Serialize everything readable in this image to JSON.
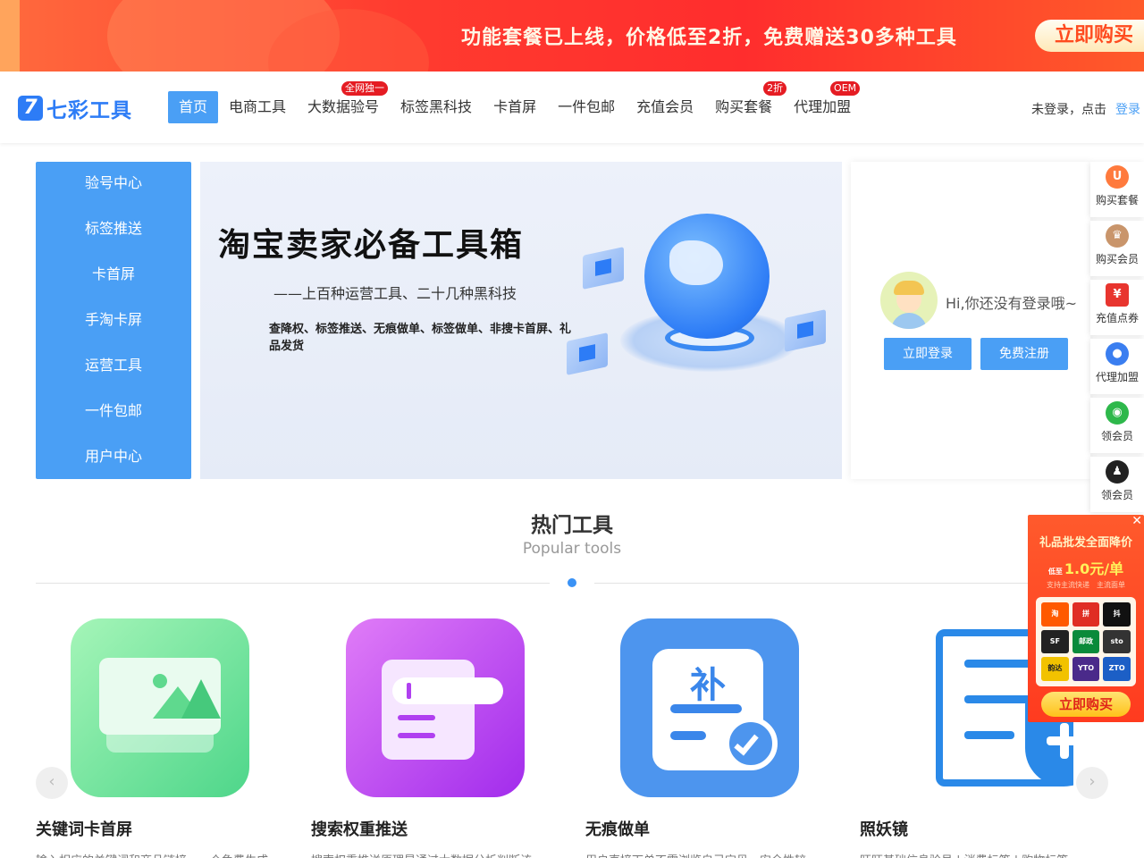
{
  "promo": {
    "text": "功能套餐已上线，价格低至2折，免费赠送30多种工具",
    "button": "立即购买"
  },
  "header": {
    "logo_mark": "7",
    "logo_text": "七彩工具",
    "nav": [
      {
        "label": "首页",
        "active": true,
        "badge": ""
      },
      {
        "label": "电商工具",
        "badge": ""
      },
      {
        "label": "大数据验号",
        "badge": "全网独一"
      },
      {
        "label": "标签黑科技",
        "badge": ""
      },
      {
        "label": "卡首屏",
        "badge": ""
      },
      {
        "label": "一件包邮",
        "badge": ""
      },
      {
        "label": "充值会员",
        "badge": ""
      },
      {
        "label": "购买套餐",
        "badge": "2折"
      },
      {
        "label": "代理加盟",
        "badge": "OEM"
      }
    ],
    "login_hint": "未登录，点击",
    "login_link": "登录"
  },
  "categories": [
    "验号中心",
    "标签推送",
    "卡首屏",
    "手淘卡屏",
    "运营工具",
    "一件包邮",
    "用户中心"
  ],
  "hero": {
    "title": "淘宝卖家必备工具箱",
    "subtitle": "——上百种运营工具、二十几种黑科技",
    "desc": "查降权、标签推送、无痕做单、标签做单、非搜卡首屏、礼品发货"
  },
  "login_panel": {
    "greeting": "Hi,你还没有登录哦~",
    "login_button": "立即登录",
    "register_button": "免费注册"
  },
  "side": [
    {
      "label": "购买套餐",
      "icon": "bag-icon",
      "color": "#ff7a3d",
      "glyph": "U"
    },
    {
      "label": "购买会员",
      "icon": "crown-icon",
      "color": "#c9956b",
      "glyph": "♛"
    },
    {
      "label": "充值点券",
      "icon": "coupon-icon",
      "color": "#e8352f",
      "glyph": "¥"
    },
    {
      "label": "代理加盟",
      "icon": "users-icon",
      "color": "#3a7ef0",
      "glyph": "●"
    },
    {
      "label": "领会员",
      "icon": "wechat-icon",
      "color": "#2eb84b",
      "glyph": "◉"
    },
    {
      "label": "领会员",
      "icon": "qq-icon",
      "color": "#222222",
      "glyph": "♟"
    }
  ],
  "section": {
    "title": "热门工具",
    "subtitle": "Popular tools"
  },
  "tools": [
    {
      "name": "关键词卡首屏",
      "desc": "输入相应的关键词和商品链接，一个免费生成"
    },
    {
      "name": "搜索权重推送",
      "desc": "搜索权重推送原理是通过大数据分析判断该"
    },
    {
      "name": "无痕做单",
      "desc": "用户直接下单不需浏览自己宝贝，安全性较"
    },
    {
      "name": "照妖镜",
      "desc": "旺旺基础信息验号 | 消费标签 | 购物标签"
    }
  ],
  "tool_glyph_3": "补",
  "ad": {
    "close": "✕",
    "title": "礼品批发全面降价",
    "price_prefix": "低至",
    "price": "1.0元/单",
    "note": "支持主流快递　主流面单",
    "logos": [
      {
        "t": "淘",
        "c": "#ff5a00"
      },
      {
        "t": "拼",
        "c": "#e02e24"
      },
      {
        "t": "抖",
        "c": "#111111"
      },
      {
        "t": "SF",
        "c": "#222222"
      },
      {
        "t": "邮政",
        "c": "#0a8a3a"
      },
      {
        "t": "sto",
        "c": "#333333"
      },
      {
        "t": "韵达",
        "c": "#f2c200"
      },
      {
        "t": "YTO",
        "c": "#4a2a8a"
      },
      {
        "t": "ZTO",
        "c": "#1c5fc6"
      }
    ],
    "button": "立即购买"
  }
}
